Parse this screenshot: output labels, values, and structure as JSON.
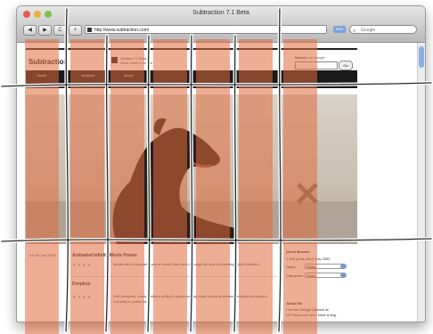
{
  "window": {
    "title": "Subtraction 7.1 Beta"
  },
  "toolbar": {
    "back": "◀",
    "forward": "▶",
    "reload": "C",
    "add": "+",
    "url": "http://www.subtraction.com/",
    "rss": "RSS",
    "search_placeholder": "Google"
  },
  "site": {
    "logo": "Subtraction",
    "version_line1": "Version 7.1 Beta",
    "version_line2": "What Walks Into Dia",
    "search_label": "Search",
    "search_sub": "via Google",
    "go": "Go",
    "nav": [
      "Home",
      "Archives",
      "About"
    ]
  },
  "entries": [
    {
      "date": "Tue 16 Jan 2008",
      "title": "Animated Infinite Movie Poster",
      "stars": "★★★★",
      "text": "Modernist re-interpretations of recent films seen through the lens of branding. Quite beautiful."
    },
    {
      "title": "Dropbox",
      "stars": "★★★★",
      "text": "Well-designed, cross-platform utility for synchronizing folder contents between multiple computers. Currently in public beta."
    }
  ],
  "sidebar": {
    "browse_title": "Quick Browse",
    "count_line": "1,438 posts since July 2002",
    "dates_label": "Dates",
    "dates_value": "Show",
    "categories_label": "Categories",
    "categories_value": "Show",
    "about_title": "About Me",
    "about_line1": "I am the Design Director at",
    "about_line2": "NYTimes.com and I have a dog."
  },
  "colors": {
    "overlay": "#e06b3f",
    "navbar": "#1a1a1a",
    "scroll_thumb": "#8cb0e6"
  }
}
